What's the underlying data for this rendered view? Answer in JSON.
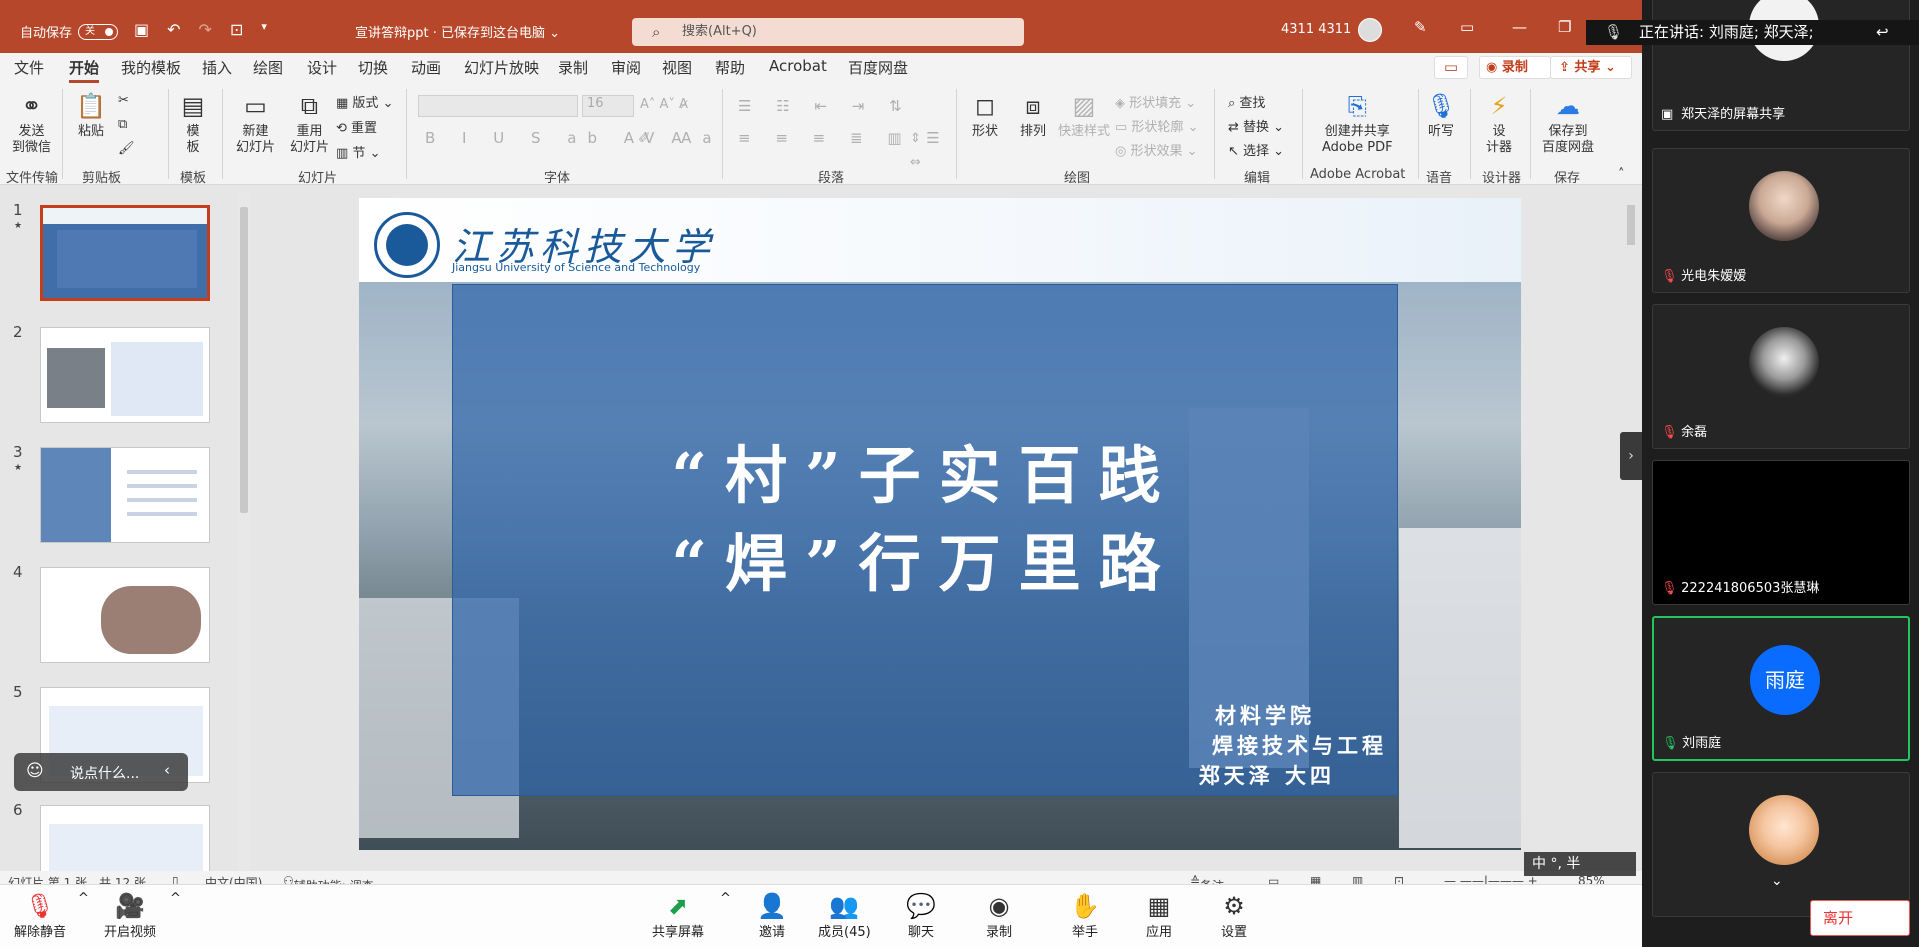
{
  "titlebar": {
    "autosave_label": "自动保存",
    "autosave_state": "关",
    "doc_title": "宣讲答辩ppt · 已保存到这台电脑",
    "search_placeholder": "搜索(Alt+Q)",
    "user_name": "4311 4311"
  },
  "tabs": [
    "文件",
    "开始",
    "我的模板",
    "插入",
    "绘图",
    "设计",
    "切换",
    "动画",
    "幻灯片放映",
    "录制",
    "审阅",
    "视图",
    "帮助",
    "Acrobat",
    "百度网盘"
  ],
  "tab_actions": {
    "record": "录制",
    "share": "共享"
  },
  "ribbon": {
    "wechat": "发送\n到微信",
    "paste": "粘贴",
    "template": "模\n板",
    "new_slide": "新建\n幻灯片",
    "reuse_slide": "重用\n幻灯片",
    "layout": "版式",
    "reset": "重置",
    "section": "节",
    "font_size": "16",
    "shapes": "形状",
    "arrange": "排列",
    "quick_styles": "快速样式",
    "shape_fill": "形状填充",
    "shape_outline": "形状轮廓",
    "shape_effects": "形状效果",
    "find": "查找",
    "replace": "替换",
    "select": "选择",
    "adobe": "创建并共享\nAdobe PDF",
    "dictate": "听写",
    "designer": "设\n计器",
    "save_baidu": "保存到\n百度网盘",
    "groups": {
      "file_transfer": "文件传输",
      "clipboard": "剪贴板",
      "template": "模板",
      "slides": "幻灯片",
      "font": "字体",
      "paragraph": "段落",
      "drawing": "绘图",
      "editing": "编辑",
      "adobe_acrobat": "Adobe Acrobat",
      "voice": "语音",
      "designer": "设计器",
      "save": "保存"
    }
  },
  "thumbnails": [
    {
      "num": "1",
      "star": true
    },
    {
      "num": "2",
      "star": false
    },
    {
      "num": "3",
      "star": true
    },
    {
      "num": "4",
      "star": false
    },
    {
      "num": "5",
      "star": false
    },
    {
      "num": "6",
      "star": false
    }
  ],
  "slide": {
    "univ_cn": "江苏科技大学",
    "univ_en": "Jiangsu University of Science and Technology",
    "title_line1": "“村”子实百践",
    "title_line2": "“焊”行万里路",
    "sub1": "材料学院",
    "sub2": "焊接技术与工程",
    "sub3": "郑天泽 大四"
  },
  "chat_placeholder": "说点什么...",
  "statusbar": {
    "slide_info": "幻灯片 第 1 张，共 12 张",
    "language": "中文(中国)",
    "accessibility": "辅助功能: 调查",
    "notes": "备注",
    "zoom": "85%"
  },
  "meeting": {
    "unmute": "解除静音",
    "start_video": "开启视频",
    "share_screen": "共享屏幕",
    "invite": "邀请",
    "members": "成员(45)",
    "chat": "聊天",
    "record": "录制",
    "raise_hand": "举手",
    "apps": "应用",
    "settings": "设置",
    "leave": "离开"
  },
  "speaking": "正在讲话: 刘雨庭; 郑天泽;",
  "participants": [
    {
      "name": "郑天泽的屏幕共享",
      "status": "sharing"
    },
    {
      "name": "光电朱嫒嫒",
      "status": "muted"
    },
    {
      "name": "余磊",
      "status": "muted"
    },
    {
      "name": "222241806503张慧琳",
      "status": "muted"
    },
    {
      "name": "刘雨庭",
      "status": "speaking",
      "avatar_text": "雨庭",
      "avatar_color": "#0a6cff"
    },
    {
      "name": "",
      "status": "muted"
    }
  ],
  "ime": "中 °, 半",
  "colors": {
    "ppt_accent": "#b7472a",
    "slide_overlay": "#2e65aa",
    "speaking_border": "#23c55e"
  }
}
